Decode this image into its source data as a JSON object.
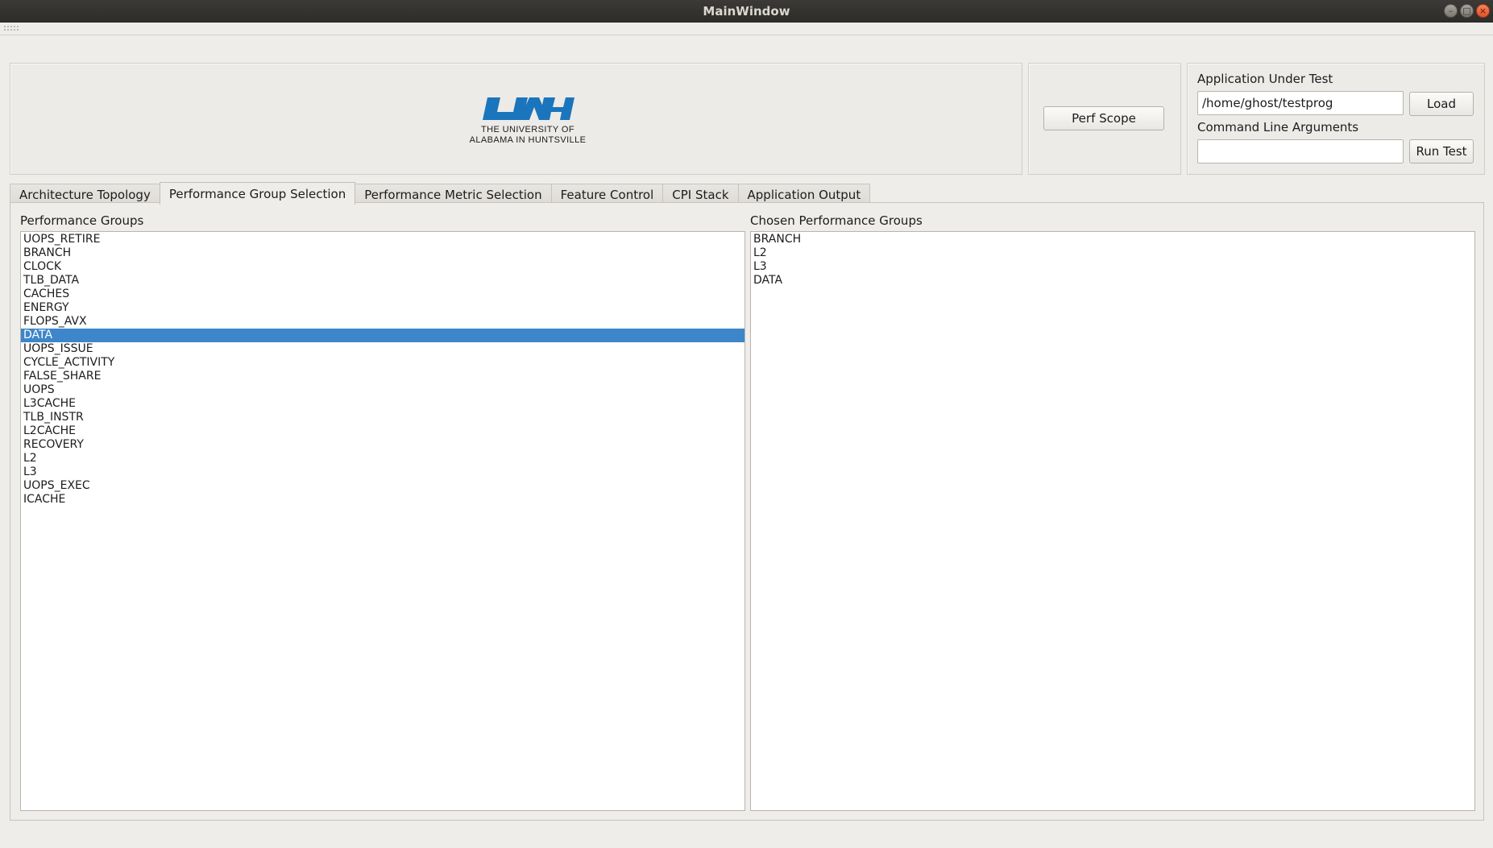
{
  "window": {
    "title": "MainWindow"
  },
  "logo": {
    "line1": "THE UNIVERSITY OF",
    "line2": "ALABAMA IN HUNTSVILLE",
    "color": "#1b75bc"
  },
  "toolbar": {
    "perf_scope_label": "Perf Scope"
  },
  "app_panel": {
    "app_label": "Application Under Test",
    "app_value": "/home/ghost/testprog",
    "load_label": "Load",
    "cmd_label": "Command Line Arguments",
    "cmd_value": "",
    "run_label": "Run Test"
  },
  "tabs": [
    {
      "label": "Architecture Topology",
      "active": false
    },
    {
      "label": "Performance Group Selection",
      "active": true
    },
    {
      "label": "Performance Metric Selection",
      "active": false
    },
    {
      "label": "Feature Control",
      "active": false
    },
    {
      "label": "CPI Stack",
      "active": false
    },
    {
      "label": "Application Output",
      "active": false
    }
  ],
  "groups": {
    "available_label": "Performance Groups",
    "chosen_label": "Chosen Performance Groups",
    "available": [
      "UOPS_RETIRE",
      "BRANCH",
      "CLOCK",
      "TLB_DATA",
      "CACHES",
      "ENERGY",
      "FLOPS_AVX",
      "DATA",
      "UOPS_ISSUE",
      "CYCLE_ACTIVITY",
      "FALSE_SHARE",
      "UOPS",
      "L3CACHE",
      "TLB_INSTR",
      "L2CACHE",
      "RECOVERY",
      "L2",
      "L3",
      "UOPS_EXEC",
      "ICACHE"
    ],
    "selected_available": "DATA",
    "chosen": [
      "BRANCH",
      "L2",
      "L3",
      "DATA"
    ],
    "selection_color": "#3d86c9"
  }
}
